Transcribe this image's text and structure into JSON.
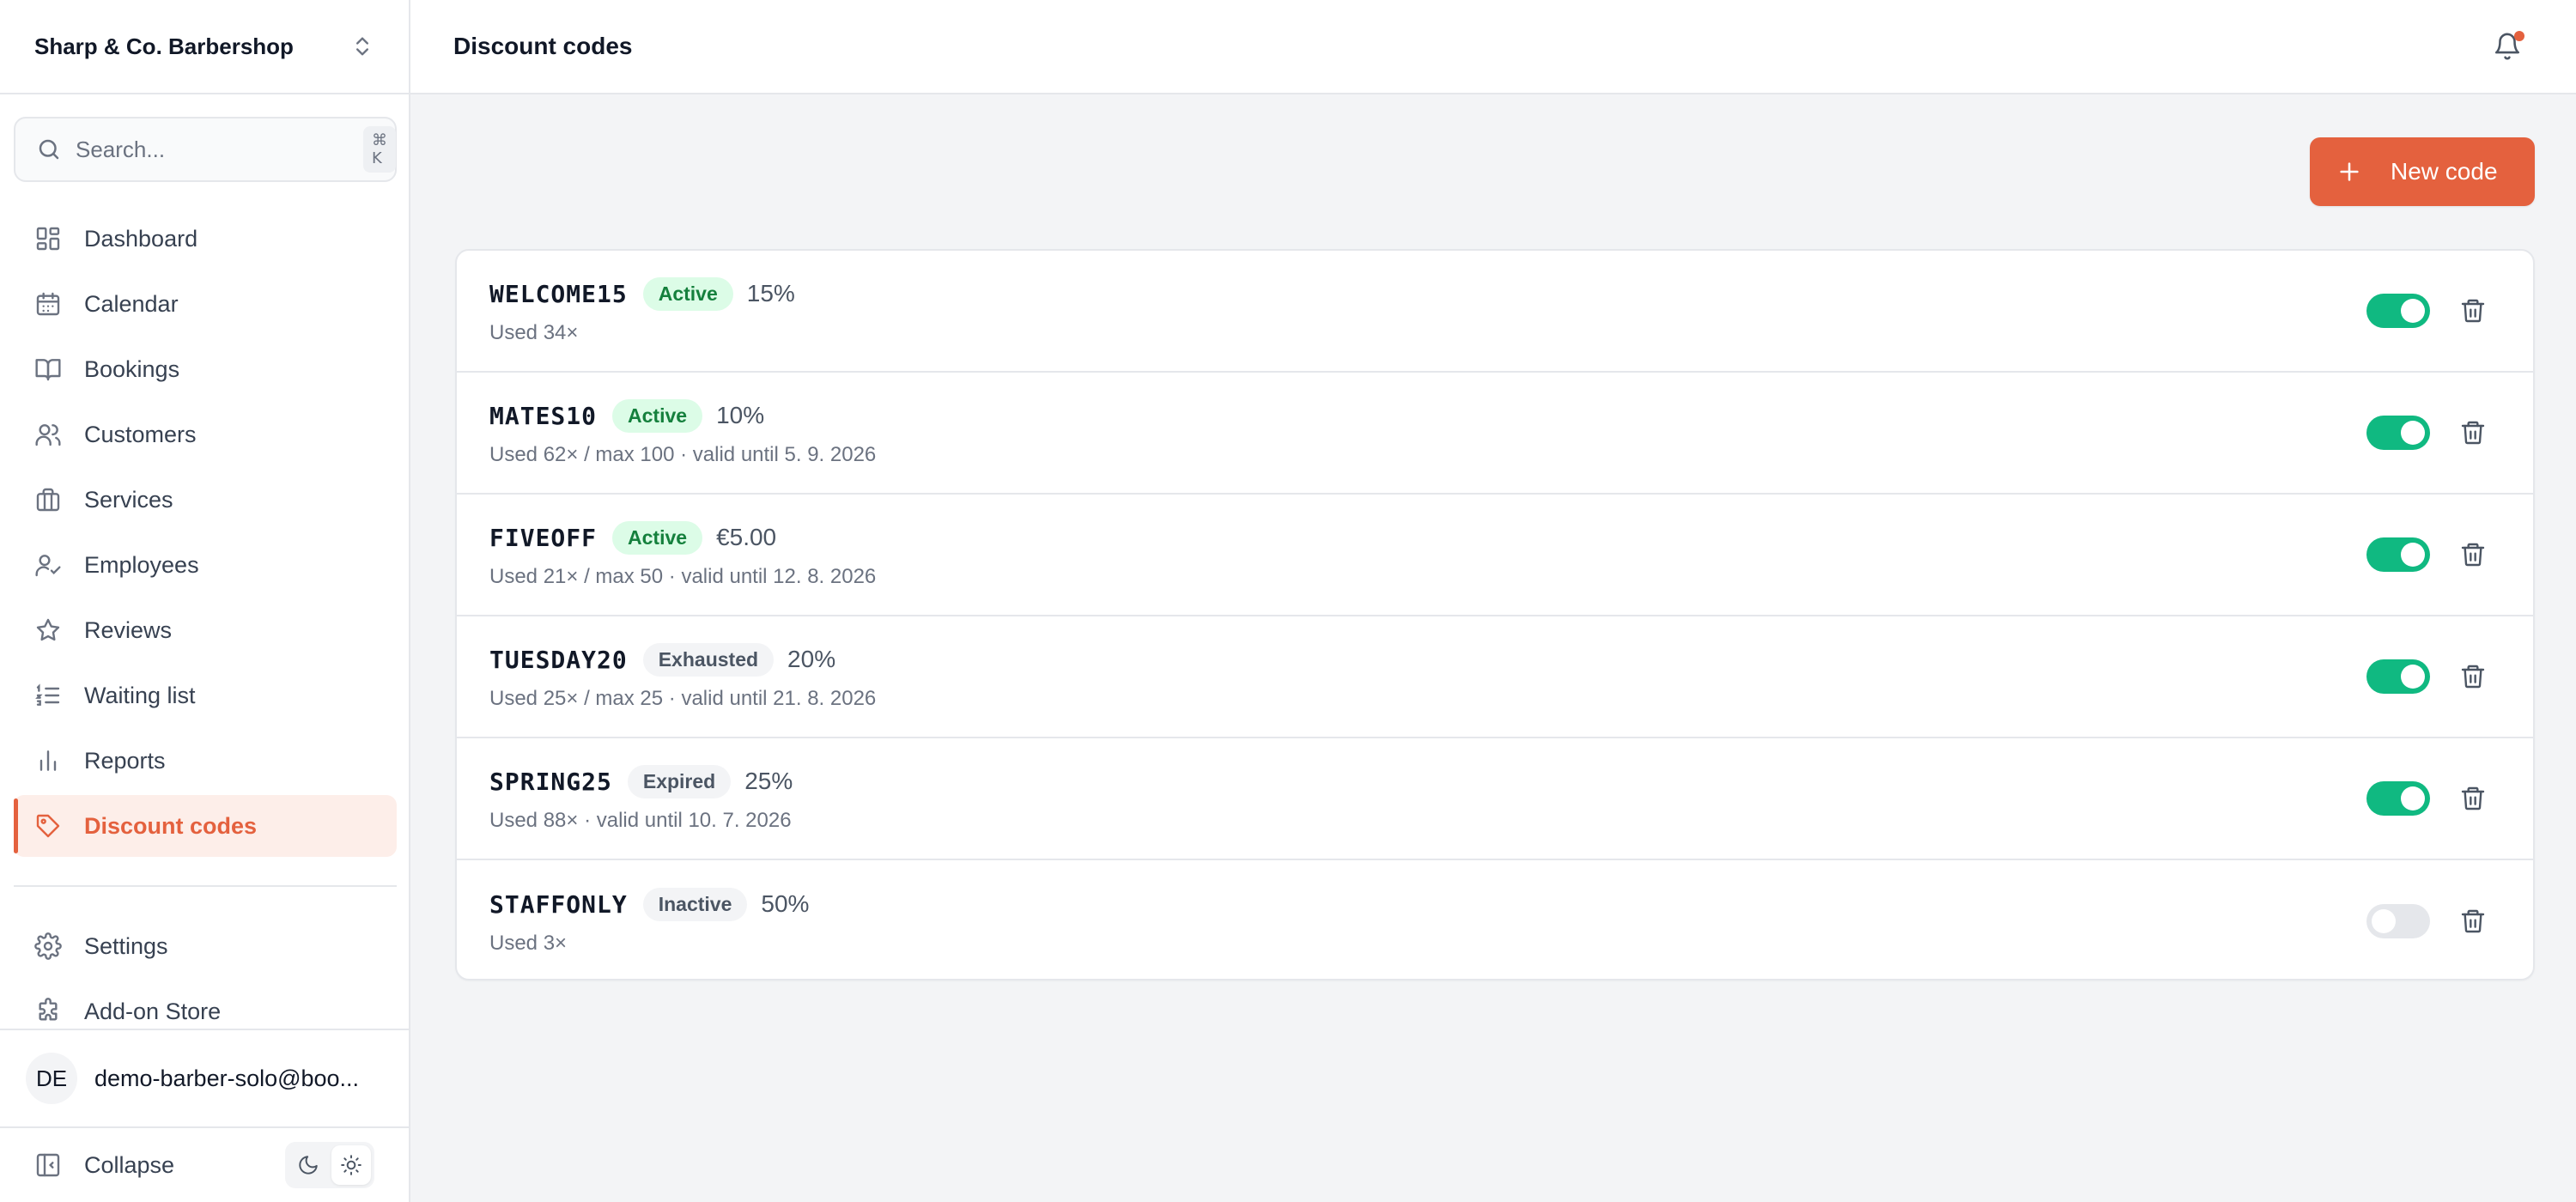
{
  "sidebar": {
    "org_name": "Sharp & Co. Barbershop",
    "search": {
      "placeholder": "Search...",
      "shortcut": "⌘ K"
    },
    "items": [
      {
        "label": "Dashboard",
        "icon": "dashboard-icon"
      },
      {
        "label": "Calendar",
        "icon": "calendar-icon"
      },
      {
        "label": "Bookings",
        "icon": "book-icon"
      },
      {
        "label": "Customers",
        "icon": "users-icon"
      },
      {
        "label": "Services",
        "icon": "briefcase-icon"
      },
      {
        "label": "Employees",
        "icon": "user-check-icon"
      },
      {
        "label": "Reviews",
        "icon": "star-icon"
      },
      {
        "label": "Waiting list",
        "icon": "list-icon"
      },
      {
        "label": "Reports",
        "icon": "bar-chart-icon"
      },
      {
        "label": "Discount codes",
        "icon": "tag-icon",
        "active": true
      }
    ],
    "secondary_items": [
      {
        "label": "Settings",
        "icon": "gear-icon"
      },
      {
        "label": "Add-on Store",
        "icon": "puzzle-icon"
      }
    ],
    "user": {
      "initials": "DE",
      "email": "demo-barber-solo@boo..."
    },
    "collapse_label": "Collapse"
  },
  "header": {
    "title": "Discount codes"
  },
  "toolbar": {
    "new_code_label": "New code"
  },
  "colors": {
    "accent": "#e4613e",
    "toggle_on": "#10b981",
    "badge_active_bg": "#dcfce7",
    "badge_active_text": "#15803d"
  },
  "codes": [
    {
      "code": "WELCOME15",
      "status": "Active",
      "amount": "15%",
      "meta": "Used 34×",
      "enabled": true
    },
    {
      "code": "MATES10",
      "status": "Active",
      "amount": "10%",
      "meta": "Used 62× / max 100 · valid until 5. 9. 2026",
      "enabled": true
    },
    {
      "code": "FIVEOFF",
      "status": "Active",
      "amount": "€5.00",
      "meta": "Used 21× / max 50 · valid until 12. 8. 2026",
      "enabled": true
    },
    {
      "code": "TUESDAY20",
      "status": "Exhausted",
      "amount": "20%",
      "meta": "Used 25× / max 25 · valid until 21. 8. 2026",
      "enabled": true
    },
    {
      "code": "SPRING25",
      "status": "Expired",
      "amount": "25%",
      "meta": "Used 88× · valid until 10. 7. 2026",
      "enabled": true
    },
    {
      "code": "STAFFONLY",
      "status": "Inactive",
      "amount": "50%",
      "meta": "Used 3×",
      "enabled": false
    }
  ]
}
